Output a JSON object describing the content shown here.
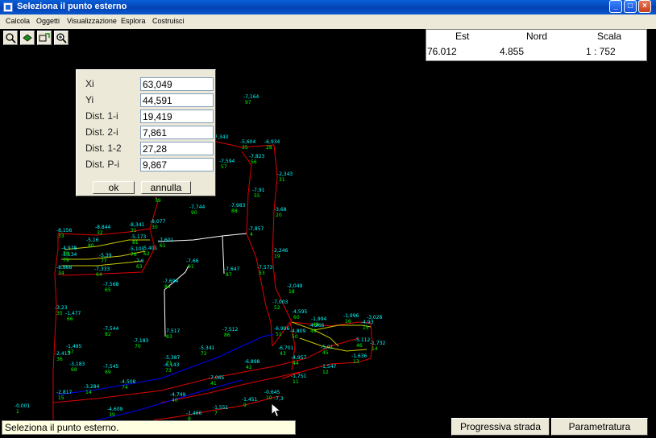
{
  "window": {
    "title": "Seleziona il punto esterno"
  },
  "menu": [
    "Calcola",
    "Oggetti",
    "Visualizzazione",
    "Esplora",
    "Costruisci"
  ],
  "toolbar": [
    {
      "icon": "zoom-icon"
    },
    {
      "icon": "pan-icon"
    },
    {
      "icon": "zoom-window-icon"
    },
    {
      "icon": "zoom-extents-icon"
    }
  ],
  "coords": {
    "est_label": "Est",
    "nord_label": "Nord",
    "scala_label": "Scala",
    "est": "76.012",
    "nord": "4.855",
    "scala": "1 : 752"
  },
  "dialog": {
    "fields": [
      {
        "label": "Xi",
        "value": "63,049"
      },
      {
        "label": "Yi",
        "value": "44,591"
      },
      {
        "label": "Dist. 1-i",
        "value": "19,419"
      },
      {
        "label": "Dist. 2-i",
        "value": "7,861"
      },
      {
        "label": "Dist. 1-2",
        "value": "27,28"
      },
      {
        "label": "Dist. P-i",
        "value": "9,867"
      }
    ],
    "ok": "ok",
    "cancel": "annulla"
  },
  "status": "Seleziona il punto esterno.",
  "buttons": {
    "progressiva": "Progressiva strada",
    "parametratura": "Parametratura"
  },
  "colors": {
    "boundary": "#e00000",
    "road": "#0000ff",
    "profile": "#ffffff",
    "contour": "#c8c800",
    "elevation_text": "#00ffff",
    "id_text": "#00ff00"
  },
  "map_labels": [
    {
      "e": "-7,164",
      "n": "97"
    },
    {
      "e": "-7,343",
      "n": ""
    },
    {
      "e": "-5,604",
      "n": "35"
    },
    {
      "e": "-6,934",
      "n": "28"
    },
    {
      "e": "-7,594",
      "n": "57"
    },
    {
      "e": "-7,823",
      "n": "56"
    },
    {
      "e": "-2,343",
      "n": "31"
    },
    {
      "e": "-7,91",
      "n": "55"
    },
    {
      "e": "-3,68",
      "n": "20"
    },
    {
      "e": "-7,744",
      "n": "90"
    },
    {
      "e": "-7,983",
      "n": "88"
    },
    {
      "e": "-7,857",
      "n": "4"
    },
    {
      "e": "-8,156",
      "n": "33"
    },
    {
      "e": "-8,844",
      "n": "32"
    },
    {
      "e": "-8,341",
      "n": "31"
    },
    {
      "e": "-8,077",
      "n": "30"
    },
    {
      "e": "-8,188",
      "n": "39"
    },
    {
      "e": "-4,978",
      "n": "78"
    },
    {
      "e": "-5,16",
      "n": "80"
    },
    {
      "e": "-5,173",
      "n": "81"
    },
    {
      "e": "-7,601",
      "n": "61"
    },
    {
      "e": "-5,134",
      "n": "79"
    },
    {
      "e": "-5,39",
      "n": "77"
    },
    {
      "e": "-5,101",
      "n": "76"
    },
    {
      "e": "-5,401",
      "n": "62"
    },
    {
      "e": "-7,6",
      "n": "63"
    },
    {
      "e": "-7,66",
      "n": "91"
    },
    {
      "e": "-7,647",
      "n": "87"
    },
    {
      "e": "-7,573",
      "n": "53"
    },
    {
      "e": "-2,246",
      "n": "19"
    },
    {
      "e": "-8,868",
      "n": "34"
    },
    {
      "e": "-7,333",
      "n": "64"
    },
    {
      "e": "-7,694",
      "n": "84"
    },
    {
      "e": "-7,568",
      "n": "65"
    },
    {
      "e": "-2,049",
      "n": "18"
    },
    {
      "e": "-7,003",
      "n": "52"
    },
    {
      "e": "-4,595",
      "n": "60"
    },
    {
      "e": "-1,994",
      "n": "48"
    },
    {
      "e": "-1,996",
      "n": "16"
    },
    {
      "e": "-4,93",
      "n": "15"
    },
    {
      "e": "-3,028",
      "n": ""
    },
    {
      "e": "-3,23",
      "n": "35"
    },
    {
      "e": "-1,477",
      "n": "66"
    },
    {
      "e": "-7,544",
      "n": "82"
    },
    {
      "e": "-7,517",
      "n": "83"
    },
    {
      "e": "-7,512",
      "n": "86"
    },
    {
      "e": "-6,996",
      "n": "51"
    },
    {
      "e": "-4,809",
      "n": "50"
    },
    {
      "e": "-4,266",
      "n": "49"
    },
    {
      "e": "-5,112",
      "n": "46"
    },
    {
      "e": "-1,732",
      "n": "14"
    },
    {
      "e": "-1,495",
      "n": "67"
    },
    {
      "e": "-2,413",
      "n": "36"
    },
    {
      "e": "-5,341",
      "n": "72"
    },
    {
      "e": "-5,387",
      "n": "71"
    },
    {
      "e": "-7,183",
      "n": "70"
    },
    {
      "e": "-6,143",
      "n": "73"
    },
    {
      "e": "-6,701",
      "n": "43"
    },
    {
      "e": "-4,957",
      "n": "44"
    },
    {
      "e": "-5,01",
      "n": "45"
    },
    {
      "e": "-1,636",
      "n": "13"
    },
    {
      "e": "-3,183",
      "n": "68"
    },
    {
      "e": "-7,545",
      "n": "69"
    },
    {
      "e": "-6,898",
      "n": "42"
    },
    {
      "e": "-1,547",
      "n": "12"
    },
    {
      "e": "-7,065",
      "n": "41"
    },
    {
      "e": "-1,751",
      "n": "11"
    },
    {
      "e": "-3,284",
      "n": "14"
    },
    {
      "e": "-4,508",
      "n": "74"
    },
    {
      "e": "-2,817",
      "n": "15"
    },
    {
      "e": "-4,749",
      "n": "40"
    },
    {
      "e": "-0,645",
      "n": "10"
    },
    {
      "e": "-1,451",
      "n": "9"
    },
    {
      "e": "-0,001",
      "n": "1"
    },
    {
      "e": "-4,609",
      "n": "39"
    },
    {
      "e": "-1,466",
      "n": "8"
    },
    {
      "e": "-1,551",
      "n": "7"
    },
    {
      "e": "-7,3",
      "n": ""
    }
  ]
}
